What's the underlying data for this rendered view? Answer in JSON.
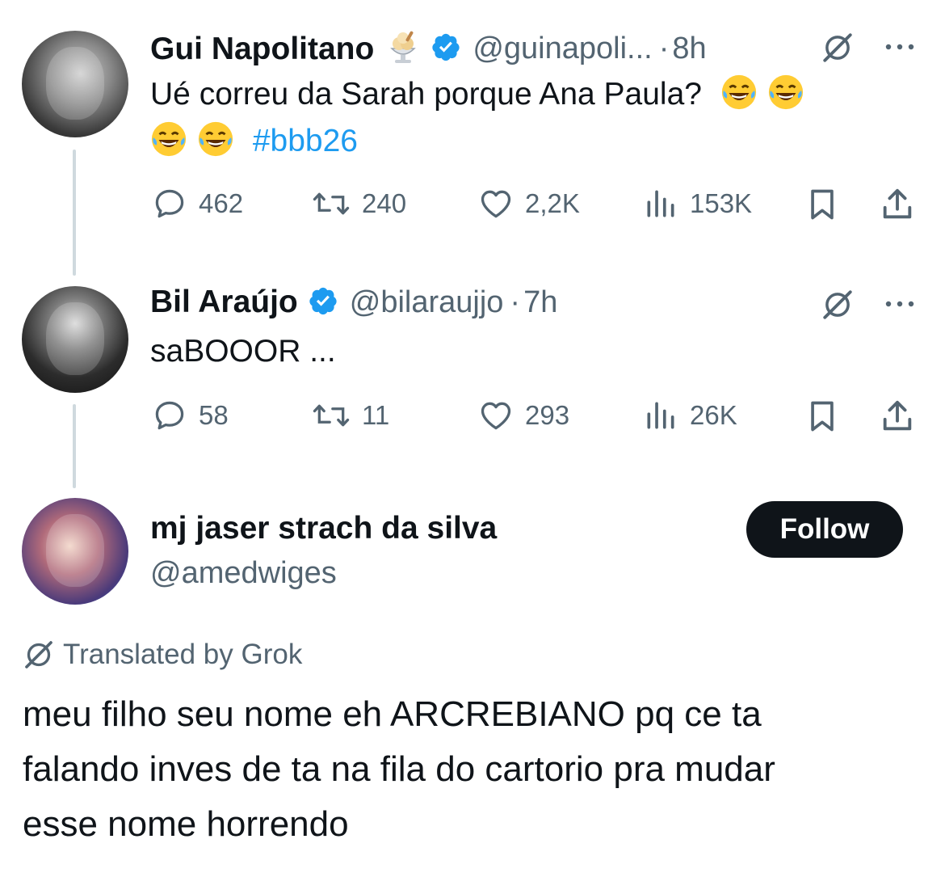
{
  "tweets": [
    {
      "name": "Gui Napolitano",
      "handle": "@guinapoli...",
      "dot": "·",
      "time": "8h",
      "text_line1": "Ué correu da Sarah porque Ana Paula?",
      "hashtag": "#bbb26",
      "replies": "462",
      "retweets": "240",
      "likes": "2,2K",
      "views": "153K"
    },
    {
      "name": "Bil Araújo",
      "handle": "@bilaraujjo",
      "dot": "·",
      "time": "7h",
      "text_line1": "saBOOOR ...",
      "replies": "58",
      "retweets": "11",
      "likes": "293",
      "views": "26K"
    }
  ],
  "main_post": {
    "name": "mj jaser strach da silva",
    "handle": "@amedwiges",
    "follow_label": "Follow",
    "translated_label": "Translated by Grok",
    "body_lines": [
      "meu filho seu nome eh ARCREBIANO pq ce ta",
      "falando inves de ta na fila do cartorio pra mudar",
      "esse nome horrendo"
    ]
  },
  "colors": {
    "accent": "#1d9bf0",
    "text": "#0f1419",
    "secondary": "#536471",
    "thread_line": "#cfd9de"
  },
  "icons": [
    "reply-icon",
    "retweet-icon",
    "like-icon",
    "views-icon",
    "bookmark-icon",
    "share-icon",
    "grok-icon",
    "more-icon",
    "verified-icon",
    "laughing-emoji",
    "ice-cream-emoji"
  ]
}
